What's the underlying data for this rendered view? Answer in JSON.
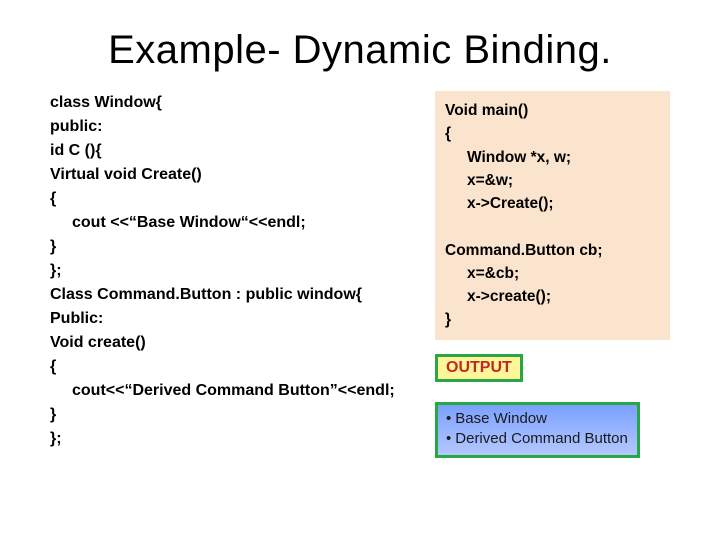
{
  "title": "Example- Dynamic Binding.",
  "left": {
    "l1": "class Window{",
    "l2": "public:",
    "l3": "id C (){",
    "l4": "Virtual void Create()",
    "l5": "{",
    "l6": "cout <<“Base Window“<<endl;",
    "l7": "}",
    "l8": "};",
    "l9": "Class Command.Button : public window{",
    "l10": "Public:",
    "l11": "Void create()",
    "l12": "{",
    "l13": "cout<<“Derived Command Button”<<endl;",
    "l14": "}",
    "l15": "};"
  },
  "right": {
    "l1": "Void main()",
    "l2": "{",
    "l3": "Window *x, w;",
    "l4": "x=&w;",
    "l5": "x->Create();",
    "l6": "Command.Button cb;",
    "l7": "x=&cb;",
    "l8": "x->create();",
    "l9": "}"
  },
  "output": {
    "label": "OUTPUT",
    "line1": "Base Window",
    "line2": "Derived Command Button"
  }
}
